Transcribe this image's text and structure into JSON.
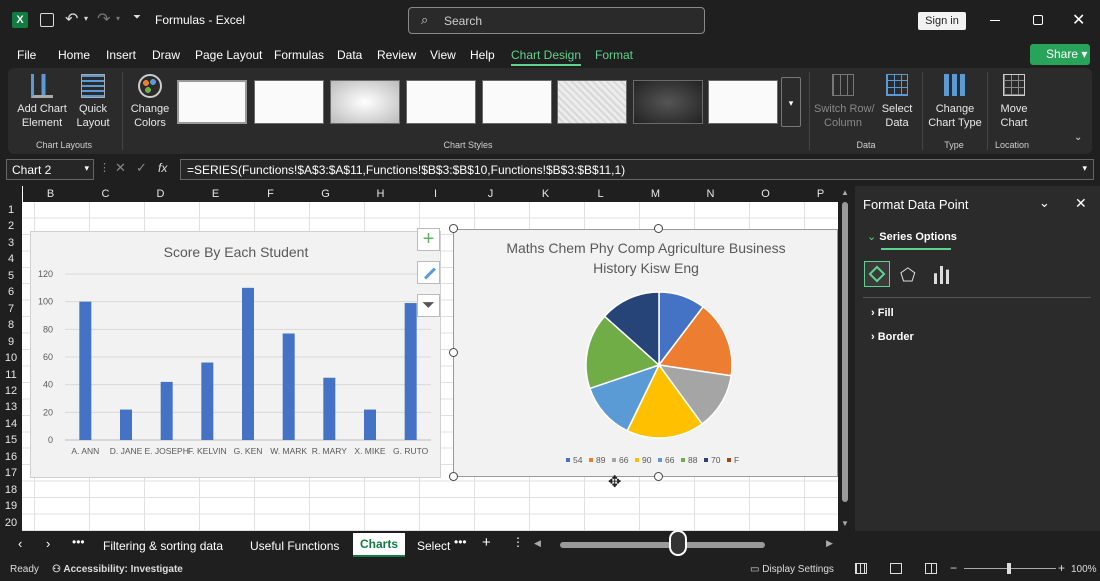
{
  "title_bar": {
    "doc_name": "Formulas",
    "app_name": "Excel",
    "search_placeholder": "Search",
    "sign_in": "Sign in"
  },
  "menu": {
    "items": [
      "File",
      "Home",
      "Insert",
      "Draw",
      "Page Layout",
      "Formulas",
      "Data",
      "Review",
      "View",
      "Help",
      "Chart Design",
      "Format"
    ],
    "share": "Share"
  },
  "ribbon": {
    "add_chart_element": "Add Chart\nElement",
    "quick_layout": "Quick\nLayout",
    "change_colors": "Change\nColors",
    "group_chart_layouts": "Chart Layouts",
    "group_chart_styles": "Chart Styles",
    "switch_row_col": "Switch Row/\nColumn",
    "select_data": "Select\nData",
    "group_data": "Data",
    "change_chart_type": "Change\nChart Type",
    "group_type": "Type",
    "move_chart": "Move\nChart",
    "group_location": "Location"
  },
  "formula_bar": {
    "name_box": "Chart 2",
    "fx": "fx",
    "formula": "=SERIES(Functions!$A$3:$A$11,Functions!$B$3:$B$10,Functions!$B$3:$B$11,1)"
  },
  "columns": [
    "B",
    "C",
    "D",
    "E",
    "F",
    "G",
    "H",
    "I",
    "J",
    "K",
    "L",
    "M",
    "N",
    "O",
    "P"
  ],
  "rows": [
    "1",
    "2",
    "3",
    "4",
    "5",
    "6",
    "7",
    "8",
    "9",
    "10",
    "11",
    "12",
    "13",
    "14",
    "15",
    "16",
    "17",
    "18",
    "19",
    "20"
  ],
  "chart_data": [
    {
      "type": "bar",
      "title": "Score By Each Student",
      "categories": [
        "A. ANN",
        "D. JANE",
        "E. JOSEPH",
        "F. KELVIN",
        "G. KEN",
        "W. MARK",
        "R. MARY",
        "X. MIKE",
        "G. RUTO"
      ],
      "values": [
        100,
        22,
        42,
        56,
        110,
        77,
        45,
        22,
        99
      ],
      "ylim": [
        0,
        120
      ],
      "yticks": [
        0,
        20,
        40,
        60,
        80,
        100,
        120
      ],
      "color": "#4472c4",
      "grid": true
    },
    {
      "type": "pie",
      "title": "Maths Chem Phy Comp Agriculture Business History Kisw Eng",
      "labels": [
        "54",
        "89",
        "66",
        "90",
        "66",
        "88",
        "70",
        "F"
      ],
      "values": [
        54,
        89,
        66,
        90,
        66,
        88,
        70
      ],
      "colors": [
        "#4472c4",
        "#ed7d31",
        "#a5a5a5",
        "#ffc000",
        "#5b9bd5",
        "#70ad47",
        "#264478",
        "#9e480e"
      ]
    }
  ],
  "panel": {
    "title": "Format Data Point",
    "section": "Series Options",
    "fill": "Fill",
    "border": "Border"
  },
  "tabs": {
    "items": [
      "Filtering & sorting data",
      "Useful Functions",
      "Charts",
      "Select"
    ],
    "active": "Charts"
  },
  "status": {
    "ready": "Ready",
    "accessibility": "Accessibility: Investigate",
    "display_settings": "Display Settings",
    "zoom": "100%"
  }
}
